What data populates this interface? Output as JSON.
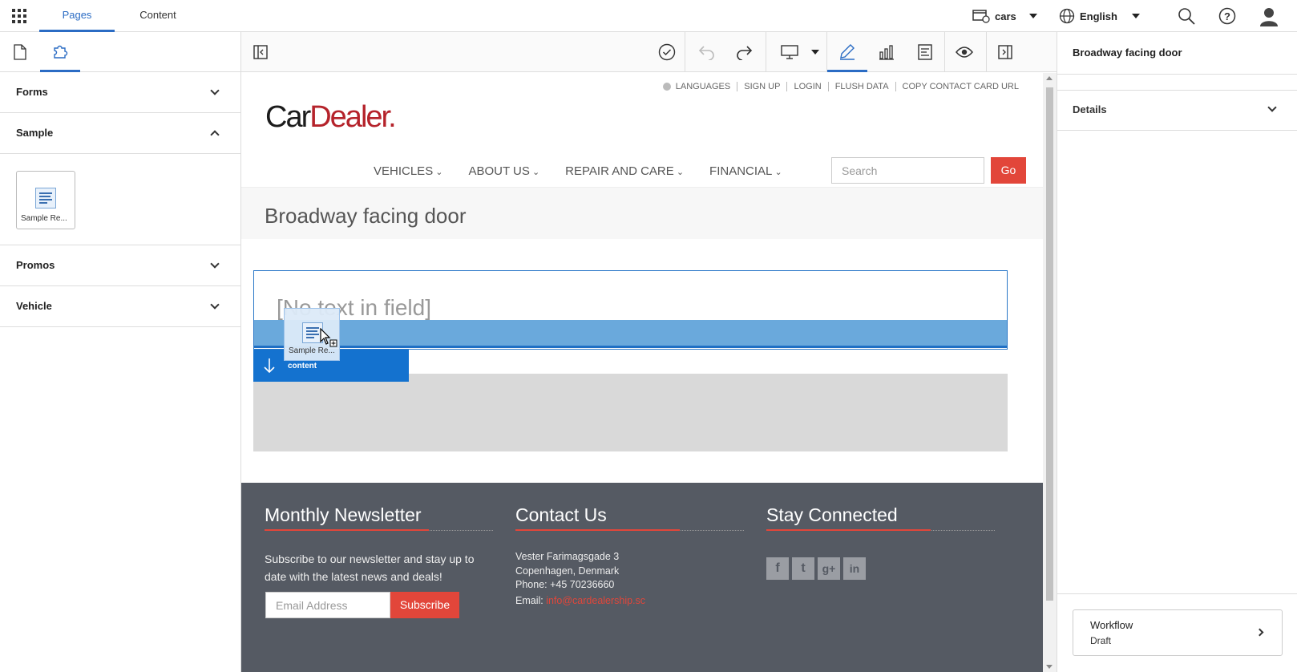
{
  "topbar": {
    "tabs": [
      "Pages",
      "Content"
    ],
    "site": "cars",
    "language": "English"
  },
  "left_panel": {
    "sections": [
      {
        "label": "Forms",
        "expanded": false
      },
      {
        "label": "Sample",
        "expanded": true
      },
      {
        "label": "Promos",
        "expanded": false
      },
      {
        "label": "Vehicle",
        "expanded": false
      }
    ],
    "sample_item_label": "Sample Re..."
  },
  "toolbar": {
    "icons": [
      "panel-left-icon",
      "check-circle-icon",
      "undo-icon",
      "redo-icon",
      "desktop-icon",
      "pencil-icon",
      "bar-chart-icon",
      "component-icon",
      "eye-icon",
      "panel-right-icon"
    ]
  },
  "right_panel": {
    "title": "Broadway facing door",
    "details_label": "Details",
    "workflow_label": "Workflow",
    "workflow_state": "Draft"
  },
  "page": {
    "utility_links": [
      "LANGUAGES",
      "SIGN UP",
      "LOGIN",
      "FLUSH DATA",
      "COPY CONTACT CARD URL"
    ],
    "logo": {
      "part1": "Car",
      "part2": "Dealer."
    },
    "nav": [
      "VEHICLES",
      "ABOUT US",
      "REPAIR AND CARE",
      "FINANCIAL"
    ],
    "search_placeholder": "Search",
    "go_label": "Go",
    "title": "Broadway facing door",
    "field_placeholder": "[No text in field]",
    "drag_label": "Sample Re...",
    "drop_label": "content",
    "footer": {
      "newsletter_title": "Monthly Newsletter",
      "newsletter_text": "Subscribe to our newsletter and stay up to date with the latest news and deals!",
      "email_placeholder": "Email Address",
      "subscribe_label": "Subscribe",
      "contact_title": "Contact Us",
      "address1": "Vester Farimagsgade 3",
      "address2": "Copenhagen, Denmark",
      "phone": "Phone: +45 70236660",
      "email_prefix": "Email: ",
      "email": "info@cardealership.sc",
      "social_title": "Stay Connected",
      "social": [
        "f",
        "t",
        "g+",
        "in"
      ]
    }
  },
  "colors": {
    "accent": "#2b6cc4",
    "brand_red": "#b5232b",
    "cta": "#e2463a",
    "footer_bg": "#555a63"
  }
}
